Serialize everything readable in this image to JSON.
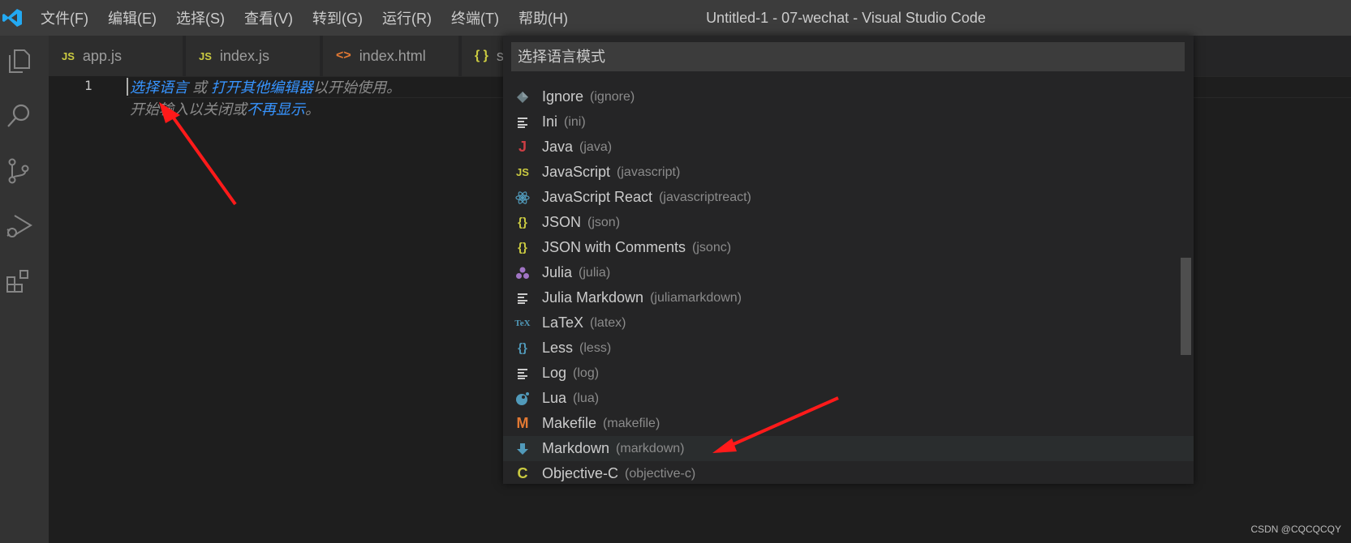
{
  "menu": [
    "文件(F)",
    "编辑(E)",
    "选择(S)",
    "查看(V)",
    "转到(G)",
    "运行(R)",
    "终端(T)",
    "帮助(H)"
  ],
  "window_title": "Untitled-1 - 07-wechat - Visual Studio Code",
  "tabs": [
    {
      "icon": "JS",
      "label": "app.js"
    },
    {
      "icon": "JS",
      "label": "index.js"
    },
    {
      "icon": "<>",
      "label": "index.html"
    },
    {
      "icon": "{ }",
      "label": "s"
    }
  ],
  "editor": {
    "line_number": "1",
    "hint_line1_link1": "选择语言",
    "hint_line1_sep": " 或 ",
    "hint_line1_link2": "打开其他编辑器",
    "hint_line1_tail": "以开始使用。",
    "hint_line2_head": "开始输入以关闭或",
    "hint_line2_link": "不再显示",
    "hint_line2_tail": "。"
  },
  "quickpick": {
    "placeholder": "选择语言模式",
    "items": [
      {
        "label": "Ignore",
        "desc": "(ignore)",
        "icon": "diamond-icon",
        "color": "#6d8086"
      },
      {
        "label": "Ini",
        "desc": "(ini)",
        "icon": "lines-icon",
        "color": "#cccccc"
      },
      {
        "label": "Java",
        "desc": "(java)",
        "icon": "java-icon",
        "color": "#cc3e44"
      },
      {
        "label": "JavaScript",
        "desc": "(javascript)",
        "icon": "js-icon",
        "color": "#cbcb41"
      },
      {
        "label": "JavaScript React",
        "desc": "(javascriptreact)",
        "icon": "react-icon",
        "color": "#519aba"
      },
      {
        "label": "JSON",
        "desc": "(json)",
        "icon": "braces-icon",
        "color": "#cbcb41"
      },
      {
        "label": "JSON with Comments",
        "desc": "(jsonc)",
        "icon": "braces-icon",
        "color": "#cbcb41"
      },
      {
        "label": "Julia",
        "desc": "(julia)",
        "icon": "julia-icon",
        "color": "#a074c4"
      },
      {
        "label": "Julia Markdown",
        "desc": "(juliamarkdown)",
        "icon": "lines-icon",
        "color": "#cccccc"
      },
      {
        "label": "LaTeX",
        "desc": "(latex)",
        "icon": "tex-icon",
        "color": "#519aba"
      },
      {
        "label": "Less",
        "desc": "(less)",
        "icon": "braces-icon",
        "color": "#519aba"
      },
      {
        "label": "Log",
        "desc": "(log)",
        "icon": "lines-icon",
        "color": "#cccccc"
      },
      {
        "label": "Lua",
        "desc": "(lua)",
        "icon": "lua-icon",
        "color": "#519aba"
      },
      {
        "label": "Makefile",
        "desc": "(makefile)",
        "icon": "m-icon",
        "color": "#e37933"
      },
      {
        "label": "Markdown",
        "desc": "(markdown)",
        "icon": "markdown-arrow-icon",
        "color": "#519aba"
      },
      {
        "label": "Objective-C",
        "desc": "(objective-c)",
        "icon": "c-icon",
        "color": "#cbcb41"
      }
    ]
  },
  "watermark": "CSDN @CQCQCQY",
  "colors": {
    "accent": "#007acc",
    "annotation_arrow": "#ff1a1a"
  }
}
